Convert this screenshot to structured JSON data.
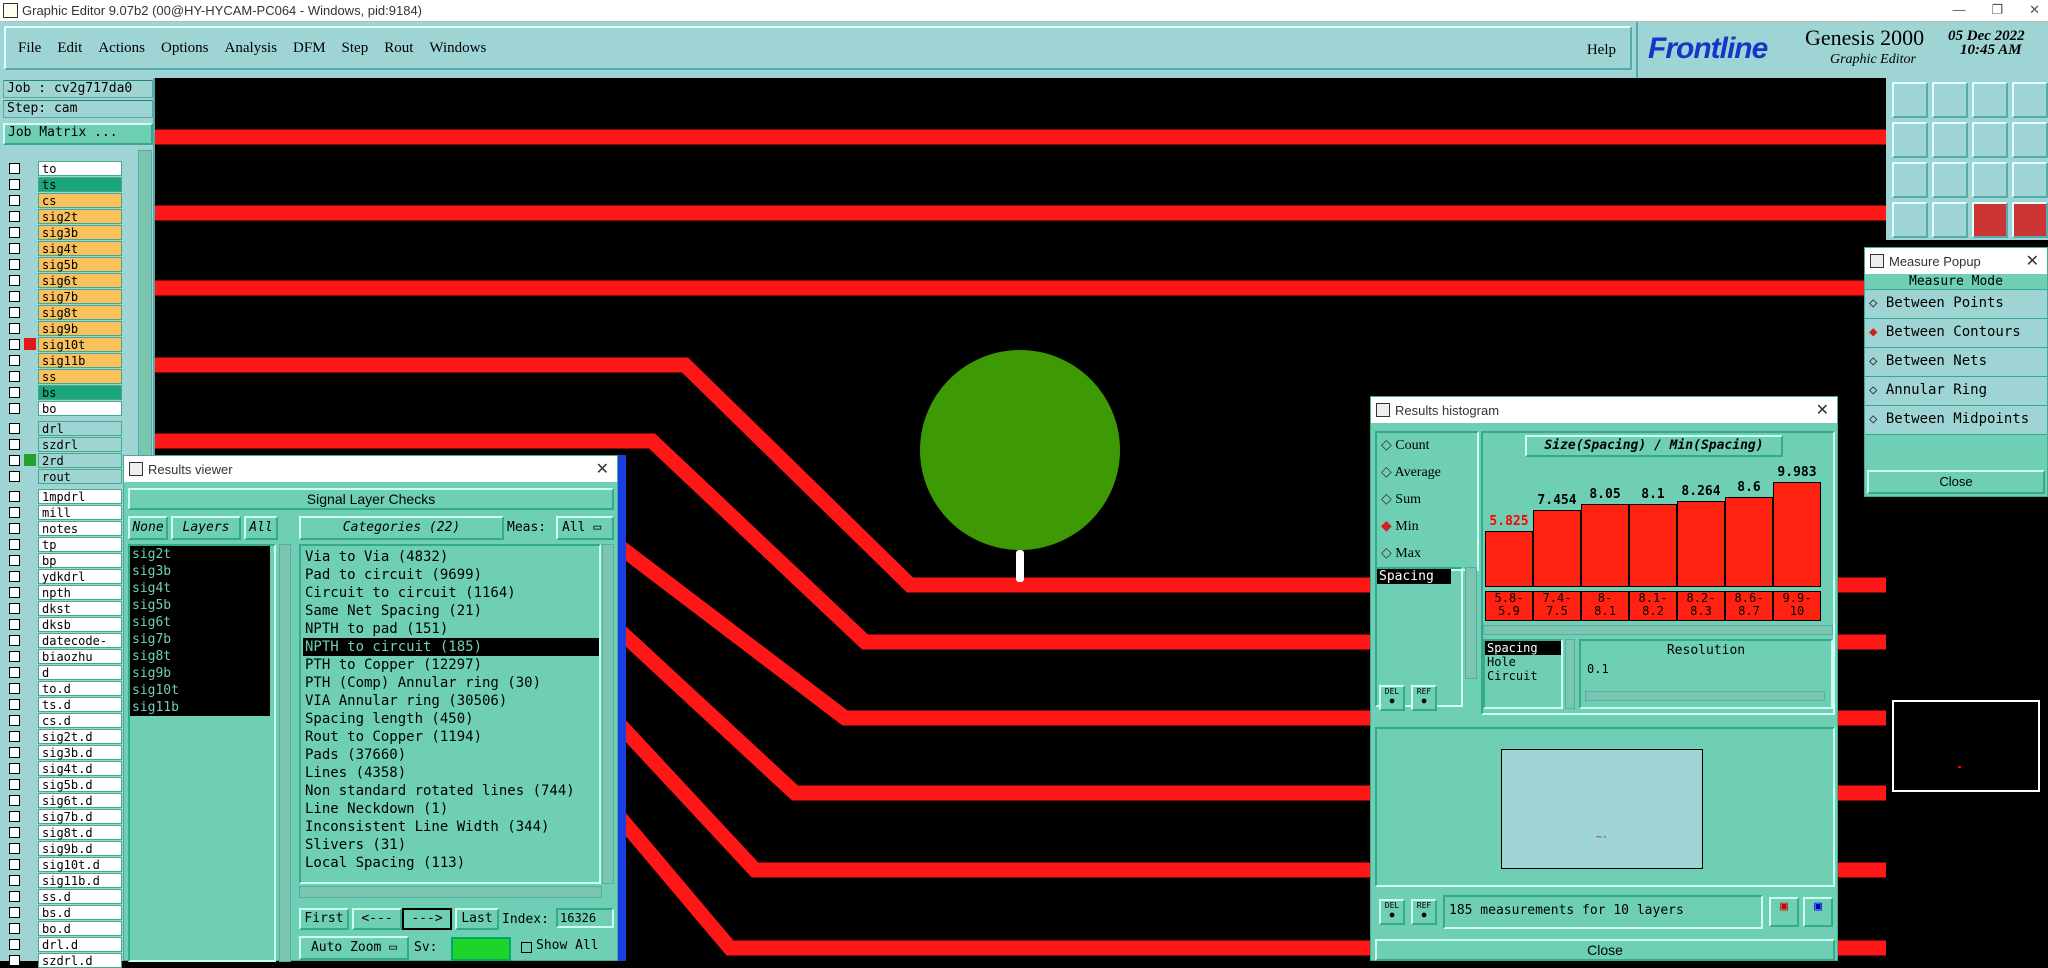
{
  "window": {
    "title": "Graphic Editor 9.07b2 (00@HY-HYCAM-PC064 - Windows, pid:9184)"
  },
  "menu": [
    "File",
    "Edit",
    "Actions",
    "Options",
    "Analysis",
    "DFM",
    "Step",
    "Rout",
    "Windows"
  ],
  "help": "Help",
  "brand": {
    "logo": "Frontline",
    "product": "Genesis 2000",
    "subtitle": "Graphic Editor",
    "date": "05 Dec 2022",
    "time": "10:45 AM"
  },
  "job": {
    "job": "Job : cv2g717da0",
    "step": "Step: cam",
    "matrix": "Job Matrix ..."
  },
  "layers_group1": [
    {
      "name": "to",
      "color": "#ffffff"
    },
    {
      "name": "ts",
      "color": "#1aa57a"
    },
    {
      "name": "cs",
      "color": "#f9c05e"
    },
    {
      "name": "sig2t",
      "color": "#f9c05e"
    },
    {
      "name": "sig3b",
      "color": "#f9c05e"
    },
    {
      "name": "sig4t",
      "color": "#f9c05e"
    },
    {
      "name": "sig5b",
      "color": "#f9c05e"
    },
    {
      "name": "sig6t",
      "color": "#f9c05e"
    },
    {
      "name": "sig7b",
      "color": "#f9c05e"
    },
    {
      "name": "sig8t",
      "color": "#f9c05e"
    },
    {
      "name": "sig9b",
      "color": "#f9c05e"
    },
    {
      "name": "sig10t",
      "color": "#f9c05e"
    },
    {
      "name": "sig11b",
      "color": "#f9c05e"
    },
    {
      "name": "ss",
      "color": "#f9c05e"
    },
    {
      "name": "bs",
      "color": "#1aa57a"
    },
    {
      "name": "bo",
      "color": "#ffffff"
    }
  ],
  "layers_group2": [
    "drl",
    "szdrl",
    "2rd",
    "rout"
  ],
  "layers_group3": [
    "1mpdrl",
    "mill",
    "notes",
    "tp",
    "bp",
    "ydkdrl",
    "npth",
    "dkst",
    "dksb",
    "datecode-to",
    "biaozhu",
    "d",
    "to.d",
    "ts.d",
    "cs.d",
    "sig2t.d",
    "sig3b.d",
    "sig4t.d",
    "sig5b.d",
    "sig6t.d",
    "sig7b.d",
    "sig8t.d",
    "sig9b.d",
    "sig10t.d",
    "sig11b.d",
    "ss.d",
    "bs.d",
    "bo.d",
    "drl.d",
    "szdrl.d"
  ],
  "results_viewer": {
    "title": "Results viewer",
    "header": "Signal Layer Checks",
    "none": "None",
    "layers": "Layers",
    "all": "All",
    "categories": "Categories (22)",
    "meas_label": "Meas:",
    "meas_value": "All",
    "layer_list": [
      "sig2t",
      "sig3b",
      "sig4t",
      "sig5b",
      "sig6t",
      "sig7b",
      "sig8t",
      "sig9b",
      "sig10t",
      "sig11b"
    ],
    "category_list": [
      "Via to Via (4832)",
      "Pad to circuit (9699)",
      "Circuit to circuit (1164)",
      "Same Net Spacing (21)",
      "NPTH to pad (151)",
      "NPTH to circuit (185)",
      "PTH to Copper (12297)",
      "PTH (Comp) Annular ring (30)",
      "VIA Annular ring (30506)",
      "Spacing length (450)",
      "Rout to Copper (1194)",
      "Pads (37660)",
      "Lines (4358)",
      "Non standard rotated lines (744)",
      "Line Neckdown (1)",
      "Inconsistent Line Width (344)",
      "Slivers (31)",
      "Local Spacing (113)"
    ],
    "selected_category": "NPTH to circuit (185)",
    "first": "First",
    "prev": "<---",
    "next": "--->",
    "last": "Last",
    "index_label": "Index:",
    "index_value": "16326",
    "auto_zoom": "Auto Zoom",
    "sv": "Sv:",
    "show_all": "Show All"
  },
  "histogram": {
    "title": "Results histogram",
    "modes": [
      "Count",
      "Average",
      "Sum",
      "Min",
      "Max"
    ],
    "selected_mode": "Min",
    "chart_title": "Size(Spacing) / Min(Spacing)",
    "type_list": [
      "Spacing"
    ],
    "bar_values": [
      "5.825",
      "7.454",
      "8.05",
      "8.1",
      "8.264",
      "8.6",
      "9.983"
    ],
    "bar_value_colors": [
      "#ff0000",
      "#000000",
      "#000000",
      "#000000",
      "#000000",
      "#000000",
      "#000000"
    ],
    "bar_fill": [
      0.44,
      0.6,
      0.65,
      0.65,
      0.67,
      0.7,
      0.82
    ],
    "ranges_top": [
      "5.8-",
      "7.4-",
      "8-",
      "8.1-",
      "8.2-",
      "8.6-",
      "9.9-"
    ],
    "ranges_bot": [
      "5.9",
      "7.5",
      "8.1",
      "8.2",
      "8.3",
      "8.7",
      "10"
    ],
    "del": "DEL",
    "ref": "REF",
    "mode_list": [
      "Spacing",
      "Hole",
      "Circuit"
    ],
    "resolution_label": "Resolution",
    "resolution_value": "0.1",
    "status": "185 measurements for 10 layers",
    "close": "Close"
  },
  "measure": {
    "title": "Measure Popup",
    "header": "Measure Mode",
    "options": [
      "Between Points",
      "Between Contours",
      "Between Nets",
      "Annular Ring",
      "Between Midpoints"
    ],
    "selected": "Between Contours",
    "close": "Close"
  }
}
